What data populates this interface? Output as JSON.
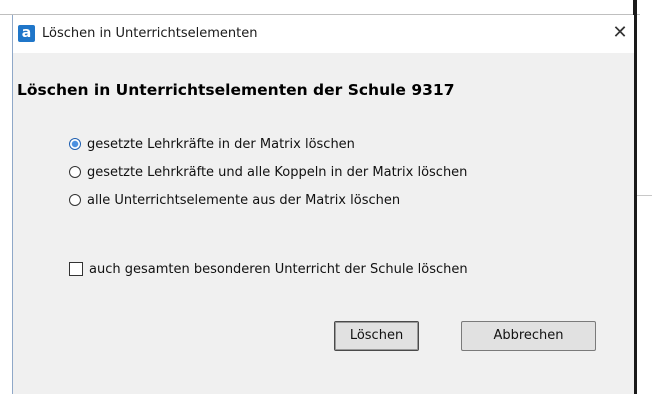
{
  "window": {
    "title": "Löschen in Unterrichtselementen",
    "app_icon_glyph": "a",
    "close_glyph": "✕"
  },
  "heading": "Löschen in Unterrichtselementen der Schule 9317",
  "options": [
    {
      "label": "gesetzte Lehrkräfte in der Matrix löschen",
      "selected": true
    },
    {
      "label": "gesetzte Lehrkräfte und alle Koppeln in der Matrix löschen",
      "selected": false
    },
    {
      "label": "alle Unterrichtselemente aus der Matrix löschen",
      "selected": false
    }
  ],
  "checkbox": {
    "label": "auch gesamten besonderen Unterricht der Schule löschen",
    "checked": false
  },
  "buttons": {
    "delete_label": "Löschen",
    "cancel_label": "Abbrechen"
  },
  "colors": {
    "dialog_bg": "#f0f0f0",
    "icon_blue": "#1f76c9",
    "radio_selected": "#4a8fe0"
  }
}
